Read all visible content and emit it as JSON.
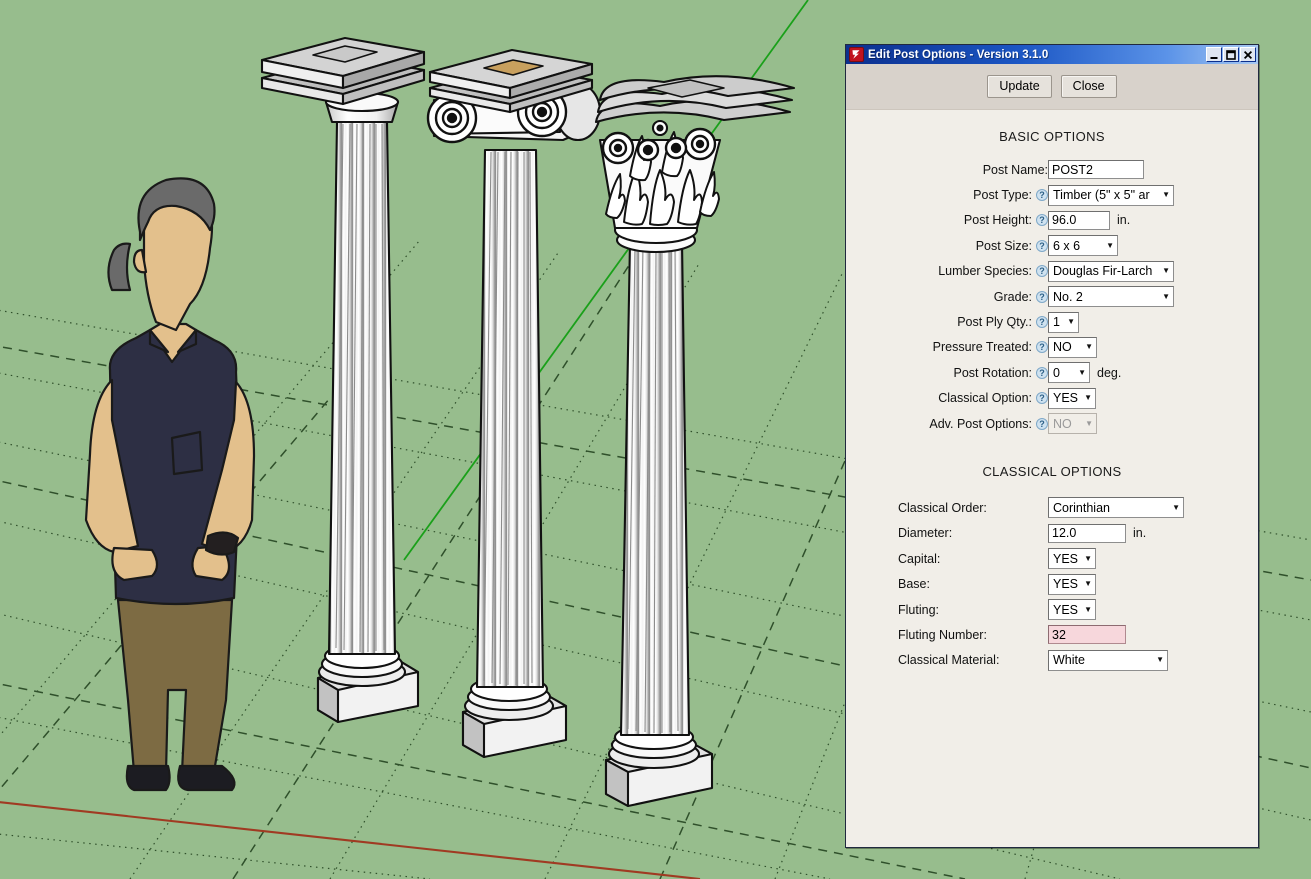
{
  "window": {
    "title": "Edit Post Options - Version 3.1.0",
    "icon": "app-icon",
    "minimize_label": "_",
    "maximize_label": "□",
    "close_label": "✕"
  },
  "toolbar": {
    "update_label": "Update",
    "close_label": "Close"
  },
  "sections": {
    "basic_title": "BASIC OPTIONS",
    "classical_title": "CLASSICAL OPTIONS"
  },
  "basic": {
    "post_name": {
      "label": "Post Name:",
      "value": "POST2",
      "help": false
    },
    "post_type": {
      "label": "Post Type:",
      "value": "Timber (5\" x 5\" ar",
      "help": true
    },
    "post_height": {
      "label": "Post Height:",
      "value": "96.0",
      "unit": "in.",
      "help": true
    },
    "post_size": {
      "label": "Post Size:",
      "value": "6 x 6",
      "help": true
    },
    "lumber_species": {
      "label": "Lumber Species:",
      "value": "Douglas Fir-Larch",
      "help": true
    },
    "grade": {
      "label": "Grade:",
      "value": "No. 2",
      "help": true
    },
    "post_ply_qty": {
      "label": "Post Ply Qty.:",
      "value": "1",
      "help": true
    },
    "pressure_treated": {
      "label": "Pressure Treated:",
      "value": "NO",
      "help": true
    },
    "post_rotation": {
      "label": "Post Rotation:",
      "value": "0",
      "unit": "deg.",
      "help": true
    },
    "classical_option": {
      "label": "Classical Option:",
      "value": "YES",
      "help": true
    },
    "adv_post_options": {
      "label": "Adv. Post Options:",
      "value": "NO",
      "help": true,
      "disabled": true
    }
  },
  "classical": {
    "classical_order": {
      "label": "Classical Order:",
      "value": "Corinthian"
    },
    "diameter": {
      "label": "Diameter:",
      "value": "12.0",
      "unit": "in."
    },
    "capital": {
      "label": "Capital:",
      "value": "YES"
    },
    "base": {
      "label": "Base:",
      "value": "YES"
    },
    "fluting": {
      "label": "Fluting:",
      "value": "YES"
    },
    "fluting_number": {
      "label": "Fluting Number:",
      "value": "32",
      "invalid": true
    },
    "classical_material": {
      "label": "Classical Material:",
      "value": "White"
    }
  },
  "help_glyph": "?",
  "arrow_glyph": "▼",
  "viewport": {
    "description": "SketchUp 3D model viewport with three classical columns and a scale figure",
    "background_color": "#97bd8d",
    "green_axis_color": "#1aa01a",
    "red_axis_color": "#a03a22",
    "columns": [
      {
        "name": "doric-column",
        "order": "Doric"
      },
      {
        "name": "ionic-column",
        "order": "Ionic"
      },
      {
        "name": "corinthian-column",
        "order": "Corinthian"
      }
    ],
    "figure": {
      "name": "scale-figure",
      "shirt_color": "#2d2f44",
      "pants_color": "#7d6b43",
      "skin_color": "#e3c08c",
      "hair_color": "#6a6a6a",
      "shoe_color": "#1c1c22"
    }
  }
}
